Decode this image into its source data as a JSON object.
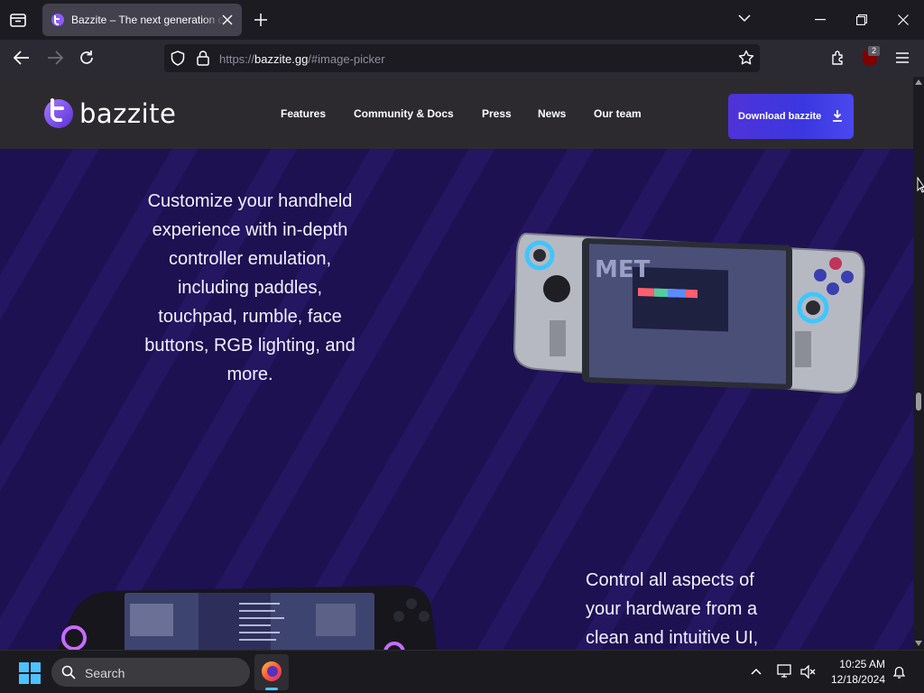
{
  "browser": {
    "tab": {
      "title": "Bazzite – The next generation of Linux gaming"
    },
    "url": {
      "scheme": "https://",
      "host": "bazzite.gg",
      "path": "/#image-picker"
    },
    "extension_badge": "2"
  },
  "site": {
    "logo_text": "bazzite",
    "nav": [
      {
        "label": "Features"
      },
      {
        "label": "Community & Docs"
      },
      {
        "label": "Press"
      },
      {
        "label": "News"
      },
      {
        "label": "Our team"
      }
    ],
    "download_label": "Download bazzite"
  },
  "content": {
    "block1": [
      "Customize your handheld",
      "experience with in-depth",
      "controller emulation,",
      "including paddles,",
      "touchpad, rumble, face",
      "buttons, RGB lighting, and",
      "more."
    ],
    "block2": [
      "Control all aspects of",
      "your hardware from a",
      "clean and intuitive UI,"
    ],
    "device_screen_text": "MET"
  },
  "taskbar": {
    "search_label": "Search",
    "time": "10:25 AM",
    "date": "12/18/2024"
  },
  "colors": {
    "accent": "#3a37e0",
    "page_bg": "#1d1152",
    "header_bg": "#2d2a2f"
  }
}
